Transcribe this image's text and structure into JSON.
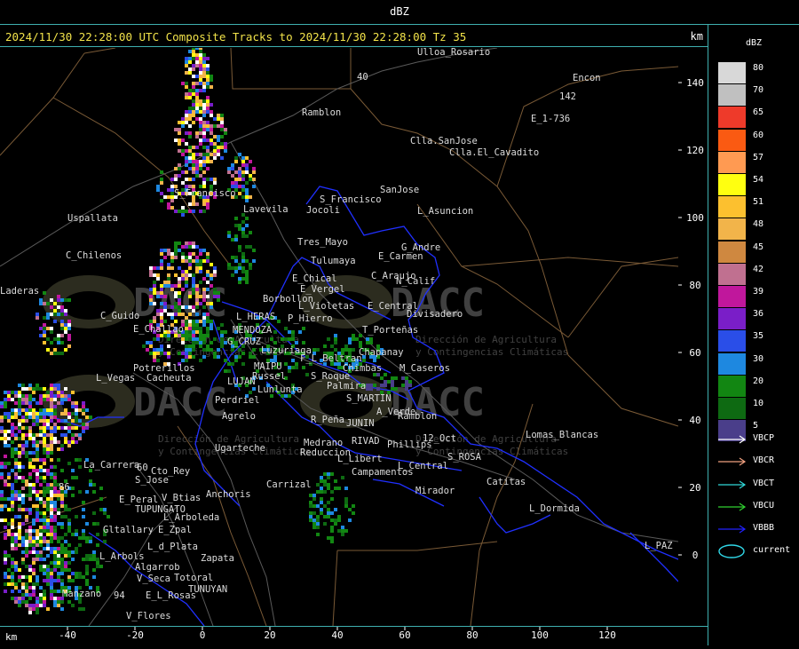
{
  "header": {
    "title": "dBZ",
    "info": "2024/11/30 22:28:00 UTC Composite Tracks to 2024/11/30 22:28:00 Tz 35",
    "unit": "km"
  },
  "legend": {
    "title": "dBZ",
    "scale": [
      {
        "label": "80",
        "color": "#d8d8d8"
      },
      {
        "label": "70",
        "color": "#c0c0c0"
      },
      {
        "label": "65",
        "color": "#ee3a2a"
      },
      {
        "label": "60",
        "color": "#fa5a12"
      },
      {
        "label": "57",
        "color": "#ff9a52"
      },
      {
        "label": "54",
        "color": "#ffff10"
      },
      {
        "label": "51",
        "color": "#fcc02f"
      },
      {
        "label": "48",
        "color": "#f2b44a"
      },
      {
        "label": "45",
        "color": "#cf8840"
      },
      {
        "label": "42",
        "color": "#c07090"
      },
      {
        "label": "39",
        "color": "#c0179c"
      },
      {
        "label": "36",
        "color": "#7a1ec8"
      },
      {
        "label": "35",
        "color": "#2a4ee8"
      },
      {
        "label": "30",
        "color": "#1e88e0"
      },
      {
        "label": "20",
        "color": "#128612"
      },
      {
        "label": "10",
        "color": "#0e6a12"
      },
      {
        "label": "5",
        "color": "#4a3e8a"
      }
    ],
    "tracks": [
      {
        "label": "VBCP",
        "color": "#ffffff"
      },
      {
        "label": "VBCR",
        "color": "#f0a080"
      },
      {
        "label": "VBCT",
        "color": "#30d8d8"
      },
      {
        "label": "VBCU",
        "color": "#30d030"
      },
      {
        "label": "VBBB",
        "color": "#2020ff"
      }
    ],
    "current_label": "current",
    "current_color": "#30d8e8"
  },
  "axes": {
    "x_unit": "km",
    "x_ticks": [
      "-40",
      "-20",
      "0",
      "20",
      "40",
      "60",
      "80",
      "100",
      "120"
    ],
    "y_ticks": [
      "140",
      "120",
      "100",
      "80",
      "60",
      "40",
      "20",
      "0"
    ]
  },
  "watermarks": [
    {
      "logo": "DACC",
      "line1": "Dirección de Agricultura",
      "line2": "y Contingencias Climáticas"
    }
  ],
  "places": [
    {
      "name": "Ulloa_Rosario"
    },
    {
      "name": "Encon"
    },
    {
      "name": "142"
    },
    {
      "name": "E_1-736"
    },
    {
      "name": "Ramblon"
    },
    {
      "name": "Clla.SanJose"
    },
    {
      "name": "Clla.El_Cavadito"
    },
    {
      "name": "S_Francisco"
    },
    {
      "name": "SanJose"
    },
    {
      "name": "Jocoli"
    },
    {
      "name": "L_Asuncion"
    },
    {
      "name": "Uspallata"
    },
    {
      "name": "Tres_Mayo"
    },
    {
      "name": "G_Andre"
    },
    {
      "name": "Tulumaya"
    },
    {
      "name": "E_Carmen"
    },
    {
      "name": "C_Chilenos"
    },
    {
      "name": "E_Chical"
    },
    {
      "name": "C_Araujo"
    },
    {
      "name": "E_Vergel"
    },
    {
      "name": "N_Calif"
    },
    {
      "name": "Borbollon"
    },
    {
      "name": "E_Central"
    },
    {
      "name": "L_Violetas"
    },
    {
      "name": "Divisadero"
    },
    {
      "name": "C_Guido"
    },
    {
      "name": "L_HERAS"
    },
    {
      "name": "P_Hierro"
    },
    {
      "name": "MENDOZA"
    },
    {
      "name": "E_Challao"
    },
    {
      "name": "T_Porteñas"
    },
    {
      "name": "G_CRUZ"
    },
    {
      "name": "Luzuriaga"
    },
    {
      "name": "Chapanay"
    },
    {
      "name": "F_L_Beltran"
    },
    {
      "name": "Potrerillos"
    },
    {
      "name": "MAIPU"
    },
    {
      "name": "Chimbas"
    },
    {
      "name": "M_Caseros"
    },
    {
      "name": "L_Vegas"
    },
    {
      "name": "Cacheuta"
    },
    {
      "name": "Russel"
    },
    {
      "name": "S_Roque"
    },
    {
      "name": "LUJAN"
    },
    {
      "name": "Lunlunta"
    },
    {
      "name": "Palmira"
    },
    {
      "name": "Perdriel"
    },
    {
      "name": "S_MARTIN"
    },
    {
      "name": "A_Verde"
    },
    {
      "name": "Agrelo"
    },
    {
      "name": "R_Peña"
    },
    {
      "name": "JUNIN"
    },
    {
      "name": "Ramblon"
    },
    {
      "name": "12_Oct"
    },
    {
      "name": "Lomas_Blancas"
    },
    {
      "name": "Medrano"
    },
    {
      "name": "RIVAD"
    },
    {
      "name": "Phillips"
    },
    {
      "name": "Ugarteche"
    },
    {
      "name": "Reduccion"
    },
    {
      "name": "L_Libert"
    },
    {
      "name": "S_ROSA"
    },
    {
      "name": "La_Carrera"
    },
    {
      "name": "L_Central"
    },
    {
      "name": "Cto_Rey"
    },
    {
      "name": "Campamentos"
    },
    {
      "name": "S_Jose"
    },
    {
      "name": "Carrizal"
    },
    {
      "name": "Catitas"
    },
    {
      "name": "Anchoris"
    },
    {
      "name": "Mirador"
    },
    {
      "name": "E_Peral"
    },
    {
      "name": "V_Btias"
    },
    {
      "name": "TUPUNGATO"
    },
    {
      "name": "L_Dormida"
    },
    {
      "name": "L_Arboleda"
    },
    {
      "name": "Gltallary"
    },
    {
      "name": "E_Zpal"
    },
    {
      "name": "L_d_Plata"
    },
    {
      "name": "L_PAZ"
    },
    {
      "name": "L_Arbols"
    },
    {
      "name": "Zapata"
    },
    {
      "name": "Algarrob"
    },
    {
      "name": "V_Seca"
    },
    {
      "name": "Totoral"
    },
    {
      "name": "Manzano"
    },
    {
      "name": "E_L_Rosas"
    },
    {
      "name": "TUNUYAN"
    },
    {
      "name": "V_Flores"
    },
    {
      "name": "Laderas"
    },
    {
      "name": "S_Francisco"
    },
    {
      "name": "Lavevila"
    },
    {
      "name": "40"
    },
    {
      "name": "94"
    },
    {
      "name": "86"
    },
    {
      "name": "60"
    }
  ]
}
